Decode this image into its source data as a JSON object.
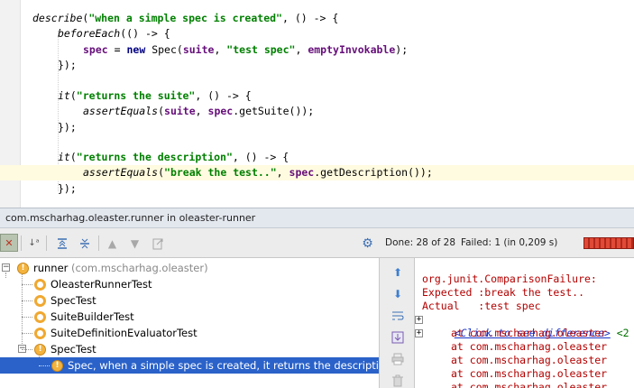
{
  "editor": {
    "lines": [
      {
        "parts": [
          {
            "t": "describe",
            "c": "it"
          },
          {
            "t": "(",
            "c": "pl"
          },
          {
            "t": "\"when a simple spec is created\"",
            "c": "str"
          },
          {
            "t": ", () -> {",
            "c": "pl"
          }
        ]
      },
      {
        "parts": [
          {
            "t": "beforeEach",
            "c": "it"
          },
          {
            "t": "(() -> {",
            "c": "pl"
          }
        ]
      },
      {
        "parts": [
          {
            "t": "spec",
            "c": "fld"
          },
          {
            "t": " = ",
            "c": "pl"
          },
          {
            "t": "new ",
            "c": "kw"
          },
          {
            "t": "Spec(",
            "c": "pl"
          },
          {
            "t": "suite",
            "c": "fld"
          },
          {
            "t": ", ",
            "c": "pl"
          },
          {
            "t": "\"test spec\"",
            "c": "str"
          },
          {
            "t": ", ",
            "c": "pl"
          },
          {
            "t": "emptyInvokable",
            "c": "fld"
          },
          {
            "t": ");",
            "c": "pl"
          }
        ]
      },
      {
        "parts": [
          {
            "t": "});",
            "c": "pl"
          }
        ]
      },
      {
        "parts": []
      },
      {
        "parts": [
          {
            "t": "it",
            "c": "it"
          },
          {
            "t": "(",
            "c": "pl"
          },
          {
            "t": "\"returns the suite\"",
            "c": "str"
          },
          {
            "t": ", () -> {",
            "c": "pl"
          }
        ]
      },
      {
        "parts": [
          {
            "t": "assertEquals",
            "c": "it"
          },
          {
            "t": "(",
            "c": "pl"
          },
          {
            "t": "suite",
            "c": "fld"
          },
          {
            "t": ", ",
            "c": "pl"
          },
          {
            "t": "spec",
            "c": "fld"
          },
          {
            "t": ".getSuite());",
            "c": "pl"
          }
        ]
      },
      {
        "parts": [
          {
            "t": "});",
            "c": "pl"
          }
        ]
      },
      {
        "parts": []
      },
      {
        "parts": [
          {
            "t": "it",
            "c": "it"
          },
          {
            "t": "(",
            "c": "pl"
          },
          {
            "t": "\"returns the description\"",
            "c": "str"
          },
          {
            "t": ", () -> {",
            "c": "pl"
          }
        ]
      },
      {
        "parts": [
          {
            "t": "assertEquals",
            "c": "it"
          },
          {
            "t": "(",
            "c": "pl"
          },
          {
            "t": "\"break the test..\"",
            "c": "str"
          },
          {
            "t": ", ",
            "c": "pl"
          },
          {
            "t": "spec",
            "c": "fld"
          },
          {
            "t": ".getDescription());",
            "c": "pl"
          }
        ]
      },
      {
        "parts": [
          {
            "t": "});",
            "c": "pl"
          }
        ]
      }
    ]
  },
  "tool_window": {
    "title": "com.mscharhag.oleaster.runner in oleaster-runner",
    "done": "Done: 28 of 28",
    "failed": "Failed: 1  (in 0,209 s)",
    "progress_fraction": 1.0
  },
  "toolbar_icons": [
    "rerun-failed-icon",
    "sort-alpha-icon",
    "expand-all-icon",
    "collapse-all-icon",
    "previous-icon",
    "next-icon",
    "export-icon",
    "settings-icon"
  ],
  "tree": [
    {
      "label": "runner",
      "sub": " (com.mscharhag.oleaster)",
      "icon": "warning"
    },
    {
      "label": "OleasterRunnerTest",
      "sub": "",
      "icon": "ring"
    },
    {
      "label": "SpecTest",
      "sub": "",
      "icon": "ring"
    },
    {
      "label": "SuiteBuilderTest",
      "sub": "",
      "icon": "ring"
    },
    {
      "label": "SuiteDefinitionEvaluatorTest",
      "sub": "",
      "icon": "ring"
    },
    {
      "label": "SpecTest",
      "sub": "",
      "icon": "warning"
    },
    {
      "label": "Spec, when a simple spec is created, it returns the description",
      "sub": "",
      "icon": "warning"
    }
  ],
  "console": {
    "exception": "org.junit.ComparisonFailure:",
    "expected": "Expected :break the test..",
    "actual": "Actual   :test spec",
    "diff_link": "<Click to see difference>",
    "diff_tail": " <2",
    "stack_lines": [
      "at com.mscharhag.oleaster",
      "at com.mscharhag.oleaster",
      "at com.mscharhag.oleaster",
      "at com.mscharhag.oleaster",
      "at com.mscharhag.oleaster"
    ]
  }
}
